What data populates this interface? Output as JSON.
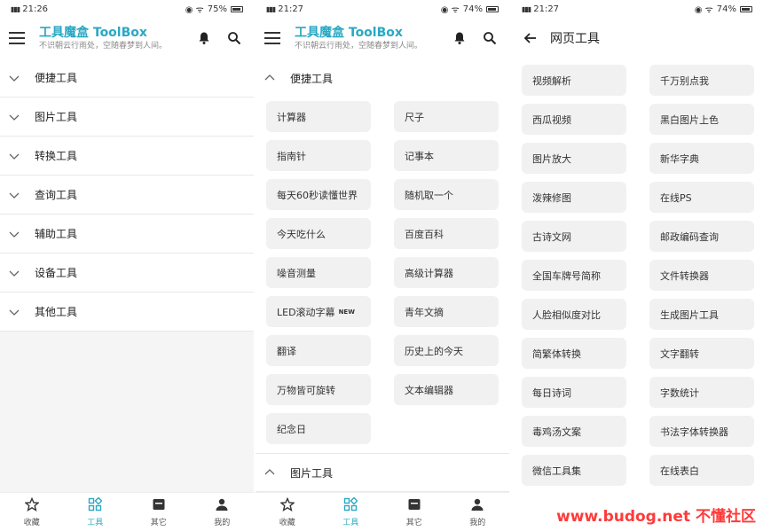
{
  "colors": {
    "accent": "#2aa8c4",
    "watermark": "#ff3a3a"
  },
  "screens": [
    {
      "status": {
        "time": "21:26",
        "battery": "75%"
      },
      "app": {
        "title": "工具魔盒 ToolBox",
        "subtitle": "不识朝云行雨处，空随春梦到人间。"
      },
      "categories": [
        "便捷工具",
        "图片工具",
        "转换工具",
        "查询工具",
        "辅助工具",
        "设备工具",
        "其他工具"
      ]
    },
    {
      "status": {
        "time": "21:27",
        "battery": "74%"
      },
      "app": {
        "title": "工具魔盒 ToolBox",
        "subtitle": "不识朝云行雨处，空随春梦到人间。"
      },
      "expanded_category": "便捷工具",
      "tools": [
        "计算器",
        "尺子",
        "指南针",
        "记事本",
        "每天60秒读懂世界",
        "随机取一个",
        "今天吃什么",
        "百度百科",
        "噪音测量",
        "高级计算器",
        "LED滚动字幕",
        "青年文摘",
        "翻译",
        "历史上的今天",
        "万物皆可旋转",
        "文本编辑器",
        "纪念日"
      ],
      "new_badge": "NEW",
      "next_category": "图片工具"
    },
    {
      "status": {
        "time": "21:27",
        "battery": "74%"
      },
      "page_title": "网页工具",
      "tools": [
        "视频解析",
        "千万别点我",
        "西瓜视频",
        "黑白图片上色",
        "图片放大",
        "新华字典",
        "泼辣修图",
        "在线PS",
        "古诗文网",
        "邮政编码查询",
        "全国车牌号简称",
        "文件转换器",
        "人脸相似度对比",
        "生成图片工具",
        "简繁体转换",
        "文字翻转",
        "每日诗词",
        "字数统计",
        "毒鸡汤文案",
        "书法字体转换器",
        "微信工具集",
        "在线表白"
      ]
    }
  ],
  "bottom_nav": [
    {
      "label": "收藏",
      "icon": "star-icon"
    },
    {
      "label": "工具",
      "icon": "tools-grid-icon",
      "active": true
    },
    {
      "label": "其它",
      "icon": "box-icon"
    },
    {
      "label": "我的",
      "icon": "person-icon"
    }
  ],
  "watermark": "www.budog.net 不懂社区"
}
